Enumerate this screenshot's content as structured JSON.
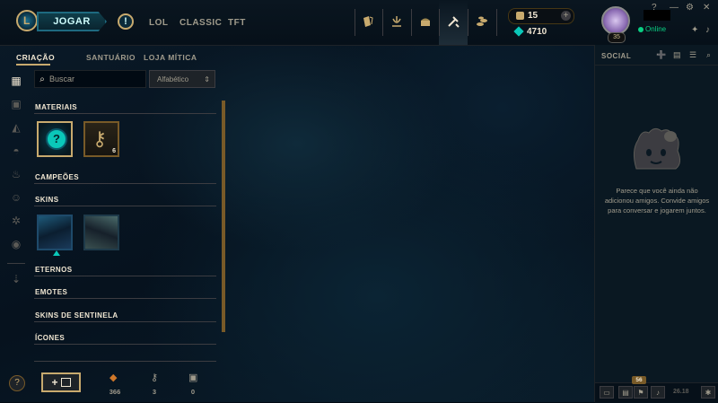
{
  "colors": {
    "gold": "#c8aa6e",
    "teal": "#0ac8b9",
    "online": "#0acf83",
    "text": "#f0e6d2"
  },
  "topnav": {
    "play_label": "JOGAR",
    "alert_icon": "!",
    "links": [
      "LOL",
      "CLASSIC",
      "TFT"
    ],
    "icons": [
      "collection-cards-icon",
      "ranked-crest-icon",
      "loot-chest-icon",
      "crafting-hammer-icon",
      "store-coins-icon"
    ]
  },
  "currency": {
    "rp": "15",
    "be": "4710",
    "add": "+"
  },
  "profile": {
    "level": "35",
    "status": "Online"
  },
  "window_controls": {
    "help": "?",
    "minimize": "—",
    "settings": "⚙",
    "close": "✕"
  },
  "subtabs": [
    "CRIAÇÃO",
    "SANTUÁRIO",
    "LOJA MÍTICA"
  ],
  "search": {
    "placeholder": "Buscar",
    "sort_value": "Alfabético"
  },
  "inventory": {
    "sections": {
      "materials": "MATERIAIS",
      "champions": "CAMPEÕES",
      "skins": "SKINS",
      "eternals": "ETERNOS",
      "emotes": "EMOTES",
      "ward_skins": "SKINS DE SENTINELA",
      "icons": "ÍCONES"
    },
    "help_item": "?",
    "key_count": "6"
  },
  "footer": {
    "craft_label": "+",
    "orange": "366",
    "keys": "3",
    "chests": "0"
  },
  "help_button": "?",
  "social": {
    "title": "SOCIAL",
    "empty_message": "Parece que você ainda não adicionou amigos. Convide amigos para conversar e jogarem juntos.",
    "badge": "56",
    "version": "26.18"
  }
}
